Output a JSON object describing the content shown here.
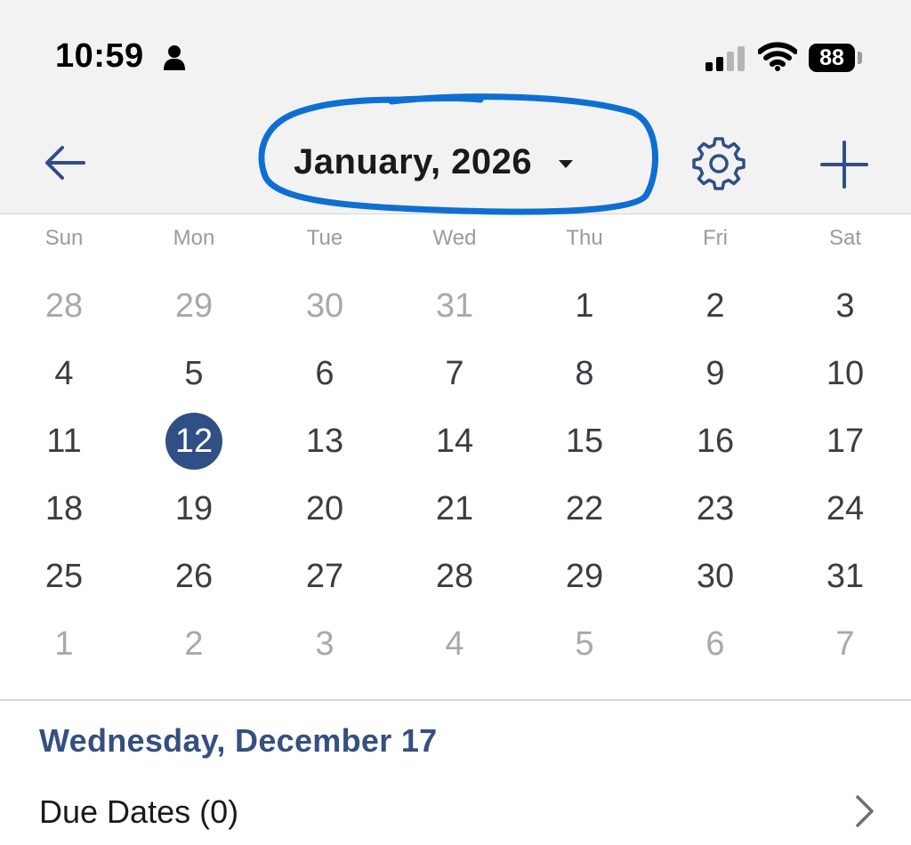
{
  "status_bar": {
    "time": "10:59",
    "battery": "88"
  },
  "nav": {
    "month_title": "January, 2026",
    "highlight_color": "#0d6fd1",
    "accent_color": "#2f4f85"
  },
  "calendar": {
    "weekdays": [
      "Sun",
      "Mon",
      "Tue",
      "Wed",
      "Thu",
      "Fri",
      "Sat"
    ],
    "weeks": [
      [
        {
          "d": "28",
          "cur": false
        },
        {
          "d": "29",
          "cur": false
        },
        {
          "d": "30",
          "cur": false
        },
        {
          "d": "31",
          "cur": false
        },
        {
          "d": "1",
          "cur": true
        },
        {
          "d": "2",
          "cur": true
        },
        {
          "d": "3",
          "cur": true
        }
      ],
      [
        {
          "d": "4",
          "cur": true
        },
        {
          "d": "5",
          "cur": true
        },
        {
          "d": "6",
          "cur": true
        },
        {
          "d": "7",
          "cur": true
        },
        {
          "d": "8",
          "cur": true
        },
        {
          "d": "9",
          "cur": true
        },
        {
          "d": "10",
          "cur": true
        }
      ],
      [
        {
          "d": "11",
          "cur": true
        },
        {
          "d": "12",
          "cur": true,
          "selected": true
        },
        {
          "d": "13",
          "cur": true
        },
        {
          "d": "14",
          "cur": true
        },
        {
          "d": "15",
          "cur": true
        },
        {
          "d": "16",
          "cur": true
        },
        {
          "d": "17",
          "cur": true
        }
      ],
      [
        {
          "d": "18",
          "cur": true
        },
        {
          "d": "19",
          "cur": true
        },
        {
          "d": "20",
          "cur": true
        },
        {
          "d": "21",
          "cur": true
        },
        {
          "d": "22",
          "cur": true
        },
        {
          "d": "23",
          "cur": true
        },
        {
          "d": "24",
          "cur": true
        }
      ],
      [
        {
          "d": "25",
          "cur": true
        },
        {
          "d": "26",
          "cur": true
        },
        {
          "d": "27",
          "cur": true
        },
        {
          "d": "28",
          "cur": true
        },
        {
          "d": "29",
          "cur": true
        },
        {
          "d": "30",
          "cur": true
        },
        {
          "d": "31",
          "cur": true
        }
      ],
      [
        {
          "d": "1",
          "cur": false
        },
        {
          "d": "2",
          "cur": false
        },
        {
          "d": "3",
          "cur": false
        },
        {
          "d": "4",
          "cur": false
        },
        {
          "d": "5",
          "cur": false
        },
        {
          "d": "6",
          "cur": false
        },
        {
          "d": "7",
          "cur": false
        }
      ]
    ]
  },
  "detail": {
    "selected_date_title": "Wednesday, December 17",
    "due_dates_label": "Due Dates (0)"
  }
}
